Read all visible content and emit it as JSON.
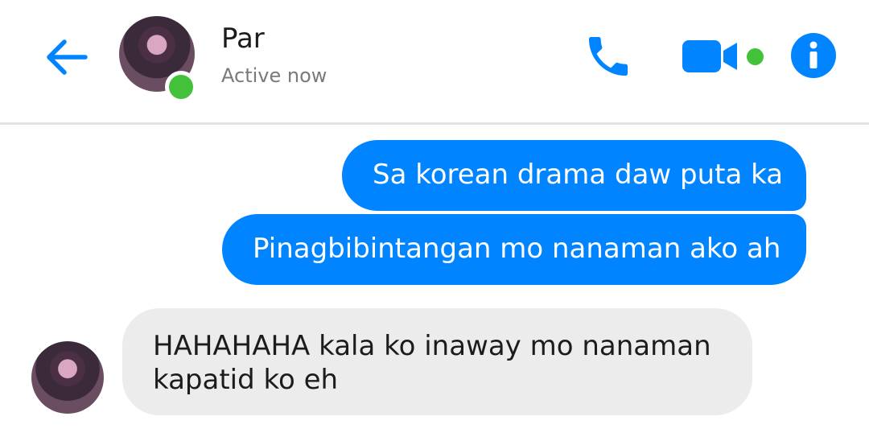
{
  "header": {
    "contact_name": "Par",
    "status": "Active now",
    "icons": {
      "back": "back-arrow-icon",
      "call": "phone-icon",
      "video": "video-camera-icon",
      "info": "info-icon"
    }
  },
  "messages": [
    {
      "direction": "sent",
      "text": "Sa korean drama daw puta ka"
    },
    {
      "direction": "sent",
      "text": "Pinagbibintangan mo nanaman ako ah"
    },
    {
      "direction": "received",
      "text": "HAHAHAHA kala ko inaway mo nanaman kapatid ko eh"
    }
  ],
  "colors": {
    "accent": "#0084ff",
    "online": "#44c13b",
    "received_bubble": "#ececec"
  }
}
